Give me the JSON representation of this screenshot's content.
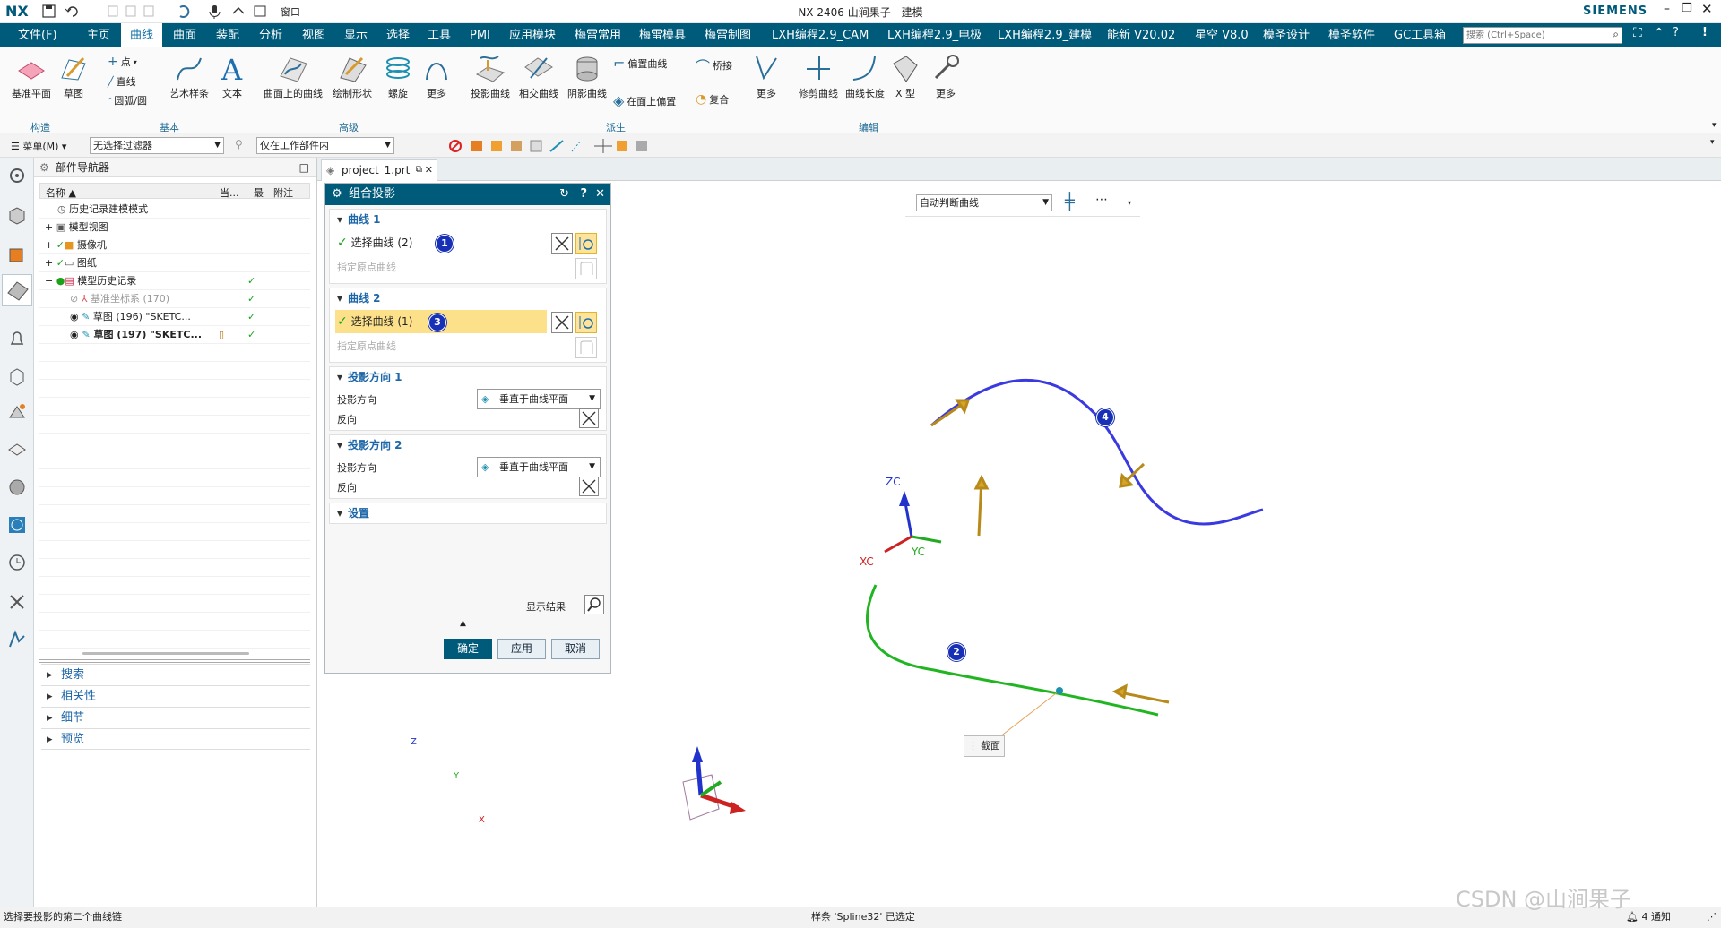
{
  "titlebar": {
    "logo": "NX",
    "window_menu": "窗口",
    "title": "NX 2406 山涧果子 - 建模",
    "brand": "SIEMENS"
  },
  "menubar": {
    "items": [
      "文件(F)",
      "主页",
      "曲线",
      "曲面",
      "装配",
      "分析",
      "视图",
      "显示",
      "选择",
      "工具",
      "PMI",
      "应用模块",
      "梅雷常用",
      "梅雷模具",
      "梅雷制图",
      "LXH编程2.9_CAM",
      "LXH编程2.9_电极",
      "LXH编程2.9_建模",
      "能新 V20.02",
      "星空 V8.0",
      "模圣设计",
      "模圣软件",
      "GC工具箱"
    ],
    "active": "曲线",
    "search_placeholder": "搜索 (Ctrl+Space)"
  },
  "ribbon": {
    "build": {
      "btn1": "基准平面",
      "btn2": "草图",
      "group": "构造"
    },
    "basic": {
      "point": "点",
      "line": "直线",
      "arc": "圆弧/圆",
      "art": "艺术样条",
      "text": "文本",
      "group": "基本"
    },
    "advanced": {
      "b1": "曲面上的曲线",
      "b2": "绘制形状",
      "b3": "螺旋",
      "b4": "更多",
      "group": "高级"
    },
    "derived": {
      "b1": "投影曲线",
      "b2": "相交曲线",
      "b3": "阴影曲线",
      "b4": "偏置曲线",
      "b5": "桥接",
      "b6": "在面上偏置",
      "b7": "复合",
      "b8": "更多",
      "group": "派生"
    },
    "edit": {
      "b1": "修剪曲线",
      "b2": "曲线长度",
      "b3": "X 型",
      "b4": "更多",
      "group": "编辑"
    }
  },
  "selbar": {
    "menu": "菜单(M)",
    "filter": "无选择过滤器",
    "scope": "仅在工作部件内"
  },
  "navigator": {
    "title": "部件导航器",
    "cols": [
      "名称",
      "当...",
      "最",
      "附注"
    ],
    "rows": [
      {
        "label": "历史记录建模模式",
        "check": false
      },
      {
        "label": "模型视图",
        "check": false
      },
      {
        "label": "摄像机",
        "check": false
      },
      {
        "label": "图纸",
        "check": false
      },
      {
        "label": "模型历史记录",
        "check": true
      },
      {
        "label": "基准坐标系 (170)",
        "check": true
      },
      {
        "label": "草图 (196) \"SKETC...",
        "check": true
      },
      {
        "label": "草图 (197) \"SKETC...",
        "check": true
      }
    ],
    "sections": [
      "搜索",
      "相关性",
      "细节",
      "预览"
    ]
  },
  "tab": {
    "file": "project_1.prt"
  },
  "dialog": {
    "title": "组合投影",
    "curve1": {
      "header": "曲线 1",
      "select": "选择曲线 (2)",
      "origin": "指定原点曲线",
      "badge": "1"
    },
    "curve2": {
      "header": "曲线 2",
      "select": "选择曲线 (1)",
      "origin": "指定原点曲线",
      "badge": "3"
    },
    "dir1": {
      "header": "投影方向 1",
      "label": "投影方向",
      "value": "垂直于曲线平面",
      "reverse": "反向"
    },
    "dir2": {
      "header": "投影方向 2",
      "label": "投影方向",
      "value": "垂直于曲线平面",
      "reverse": "反向"
    },
    "settings": {
      "header": "设置"
    },
    "show_result": "显示结果",
    "ok": "确定",
    "apply": "应用",
    "cancel": "取消"
  },
  "viewport": {
    "curve_rule": "自动判断曲线",
    "badge2": "2",
    "badge4": "4",
    "axes": {
      "zc": "ZC",
      "xc": "XC",
      "yc": "YC"
    },
    "section_label": "截面",
    "triad": {
      "z": "Z",
      "y": "Y",
      "x": "X"
    },
    "colors": {
      "curve_blue": "#3a3ae0",
      "curve_green": "#22b522",
      "arrow": "#c9a12a"
    }
  },
  "status": {
    "left": "选择要投影的第二个曲线链",
    "center": "样条 'Spline32' 已选定",
    "right": "4 通知",
    "watermark": "CSDN @山涧果子"
  }
}
